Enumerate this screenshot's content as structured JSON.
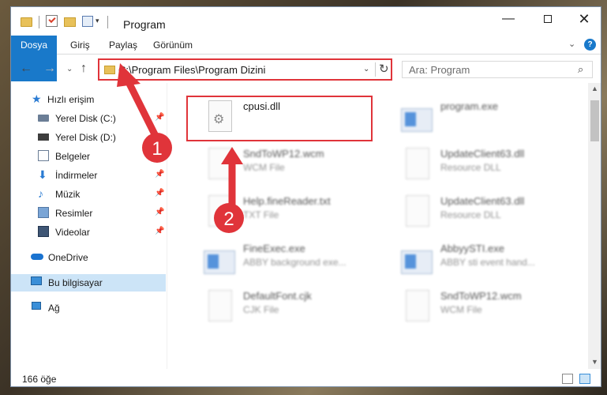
{
  "window": {
    "title": "Program",
    "minimize_glyph": "—",
    "maximize_glyph": "",
    "close_glyph": "✕"
  },
  "ribbon": {
    "tabs": [
      "Dosya",
      "Giriş",
      "Paylaş",
      "Görünüm"
    ],
    "expand_glyph": "⌄",
    "help_glyph": "?"
  },
  "nav": {
    "back_glyph": "←",
    "forward_glyph": "→",
    "recent_glyph": "⌄",
    "up_glyph": "↑"
  },
  "address": {
    "path": "C:\\Program Files\\Program Dizini",
    "dropdown_glyph": "⌄",
    "refresh_glyph": "↻"
  },
  "search": {
    "placeholder": "Ara: Program",
    "icon_glyph": "⌕"
  },
  "sidebar": {
    "pin_glyph": "📌",
    "items": [
      {
        "label": "Hızlı erişim",
        "icon": "star-icon",
        "glyph": "★"
      },
      {
        "label": "Yerel Disk (C:)",
        "icon": "disk-icon",
        "glyph": ""
      },
      {
        "label": "Yerel Disk (D:)",
        "icon": "disk-icon",
        "glyph": ""
      },
      {
        "label": "Belgeler",
        "icon": "document-icon",
        "glyph": ""
      },
      {
        "label": "İndirmeler",
        "icon": "download-icon",
        "glyph": "⬇"
      },
      {
        "label": "Müzik",
        "icon": "music-icon",
        "glyph": "♪"
      },
      {
        "label": "Resimler",
        "icon": "pictures-icon",
        "glyph": ""
      },
      {
        "label": "Videolar",
        "icon": "video-icon",
        "glyph": ""
      },
      {
        "label": "OneDrive",
        "icon": "cloud-icon",
        "glyph": ""
      },
      {
        "label": "Bu bilgisayar",
        "icon": "computer-icon",
        "glyph": ""
      },
      {
        "label": "Ağ",
        "icon": "network-icon",
        "glyph": ""
      }
    ]
  },
  "files": [
    {
      "name": "cpusi.dll",
      "type": ""
    },
    {
      "name": "program.exe",
      "type": ""
    },
    {
      "name": "SndToWP12.wcm",
      "type": "WCM File"
    },
    {
      "name": "UpdateClient63.dll",
      "type": "Resource DLL"
    },
    {
      "name": "Help.fineReader.txt",
      "type": "TXT File"
    },
    {
      "name": "UpdateClient63.dll",
      "type": "Resource DLL"
    },
    {
      "name": "FineExec.exe",
      "type": "ABBY background exe..."
    },
    {
      "name": "AbbyySTI.exe",
      "type": "ABBY sti event hand..."
    },
    {
      "name": "DefaultFont.cjk",
      "type": "CJK File"
    },
    {
      "name": "SndToWP12.wcm",
      "type": "WCM File"
    }
  ],
  "scrollbar": {
    "up_glyph": "▲",
    "down_glyph": "▼"
  },
  "status": {
    "item_count": "166 öğe"
  },
  "annotations": [
    {
      "label": "1"
    },
    {
      "label": "2"
    }
  ],
  "colors": {
    "accent": "#1979ca",
    "highlight": "#e0343a",
    "selected": "#cce4f7"
  }
}
